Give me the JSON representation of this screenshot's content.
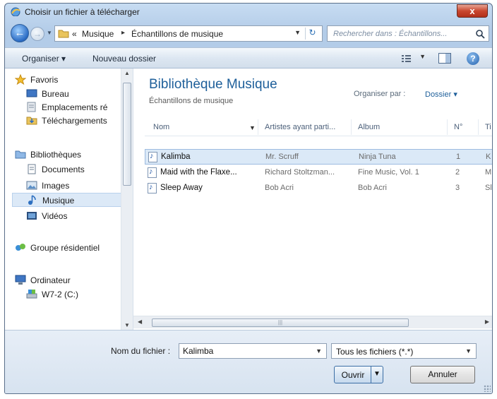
{
  "window": {
    "title": "Choisir un fichier à télécharger",
    "close_label": "x"
  },
  "address": {
    "prefix": "«",
    "crumbs": [
      "Musique",
      "Échantillons de musique"
    ],
    "separator": "▸"
  },
  "search": {
    "placeholder": "Rechercher dans : Échantillons..."
  },
  "toolbar": {
    "organize": "Organiser ▾",
    "new_folder": "Nouveau dossier",
    "help": "?"
  },
  "nav": {
    "favorites": {
      "label": "Favoris",
      "items": [
        "Bureau",
        "Emplacements ré",
        "Téléchargements"
      ]
    },
    "libraries": {
      "label": "Bibliothèques",
      "items": [
        "Documents",
        "Images",
        "Musique",
        "Vidéos"
      ],
      "selected": "Musique"
    },
    "homegroup": "Groupe résidentiel",
    "computer": {
      "label": "Ordinateur",
      "items": [
        "W7-2 (C:)"
      ]
    }
  },
  "library": {
    "title": "Bibliothèque Musique",
    "subtitle": "Échantillons de musique",
    "arrange_label": "Organiser par :",
    "arrange_value": "Dossier ▾"
  },
  "columns": [
    "Nom",
    "Artistes ayant parti...",
    "Album",
    "N°",
    "Ti"
  ],
  "files": [
    {
      "name": "Kalimba",
      "artist": "Mr. Scruff",
      "album": "Ninja Tuna",
      "num": "1",
      "title": "K"
    },
    {
      "name": "Maid with the Flaxe...",
      "artist": "Richard Stoltzman...",
      "album": "Fine Music, Vol. 1",
      "num": "2",
      "title": "M"
    },
    {
      "name": "Sleep Away",
      "artist": "Bob Acri",
      "album": "Bob Acri",
      "num": "3",
      "title": "Sl"
    }
  ],
  "selected_file": "Kalimba",
  "bottom": {
    "filename_label": "Nom du fichier :",
    "filename_value": "Kalimba",
    "filter_value": "Tous les fichiers (*.*)",
    "open_label": "Ouvrir",
    "cancel_label": "Annuler"
  },
  "colors": {
    "accent": "#1e5f9a",
    "selection": "#dbe9f7",
    "close": "#c9472f"
  }
}
